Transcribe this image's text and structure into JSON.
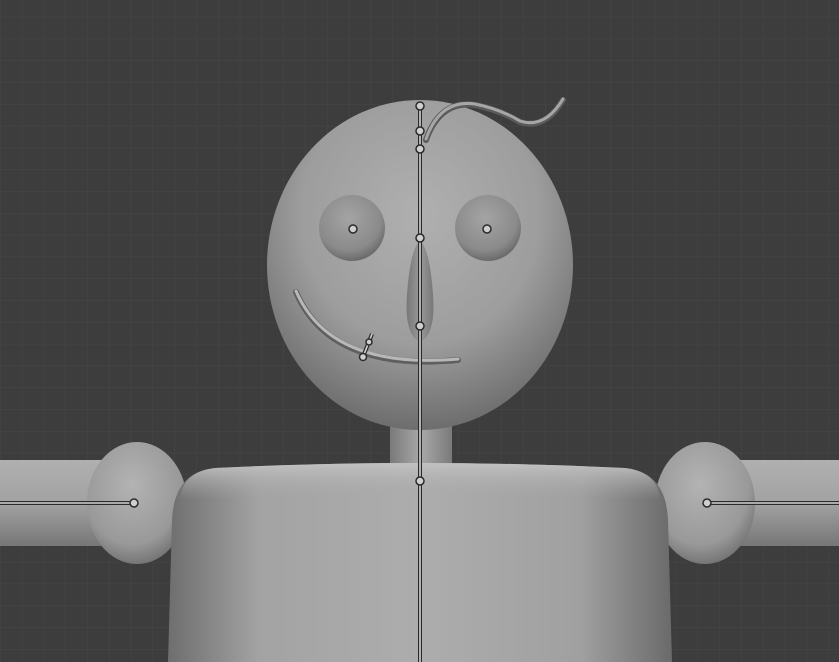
{
  "viewport": {
    "background_color": "#3d3d3d",
    "grid_minor_color": "#474747",
    "grid_major_color": "#4e4e4e"
  },
  "model": {
    "body_color": "#a9a9a9",
    "eye_color": "#9a9a9a",
    "nose_color": "#8e8e8e",
    "mouth_color": "#b4b4b4",
    "hair_curve_color": "#a2a2a2"
  },
  "armature": {
    "bone_color": "#d8d8d8",
    "bone_outline_color": "#2a2a2a",
    "joint_fill_color": "#cfcfcf"
  },
  "icons": {
    "eye_joint_left": "bone-joint-icon",
    "eye_joint_right": "bone-joint-icon"
  }
}
